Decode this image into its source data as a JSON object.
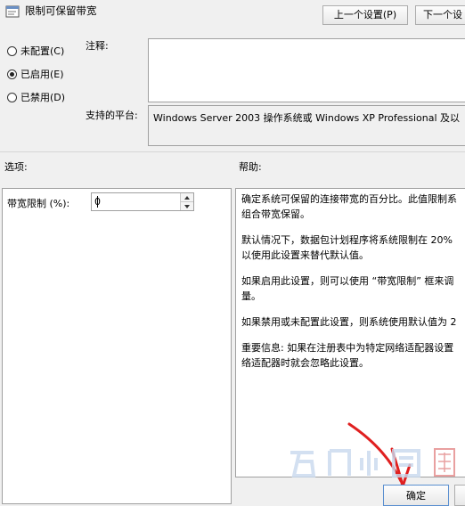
{
  "window": {
    "title": "限制可保留带宽"
  },
  "nav": {
    "prev_label": "上一个设置(P)",
    "next_label": "下一个设"
  },
  "state_options": [
    {
      "label": "未配置(C)",
      "checked": false
    },
    {
      "label": "已启用(E)",
      "checked": true
    },
    {
      "label": "已禁用(D)",
      "checked": false
    }
  ],
  "comment": {
    "label": "注释:",
    "value": ""
  },
  "platform": {
    "label": "支持的平台:",
    "value": "Windows Server 2003 操作系统或 Windows XP Professional 及以"
  },
  "options_section": {
    "label": "选项:",
    "bandwidth_label": "带宽限制 (%):",
    "bandwidth_value": "0"
  },
  "help_section": {
    "label": "帮助:",
    "paragraphs": [
      "确定系统可保留的连接带宽的百分比。此值限制系",
      "组合带宽保留。",
      "默认情况下，数据包计划程序将系统限制在 20%",
      "以使用此设置来替代默认值。",
      "如果启用此设置，则可以使用 “带宽限制” 框来调",
      "量。",
      "如果禁用或未配置此设置，则系统使用默认值为 2",
      "重要信息: 如果在注册表中为特定网络适配器设置",
      "络适配器时就会忽略此设置。"
    ]
  },
  "footer": {
    "ok_label": "确定"
  }
}
